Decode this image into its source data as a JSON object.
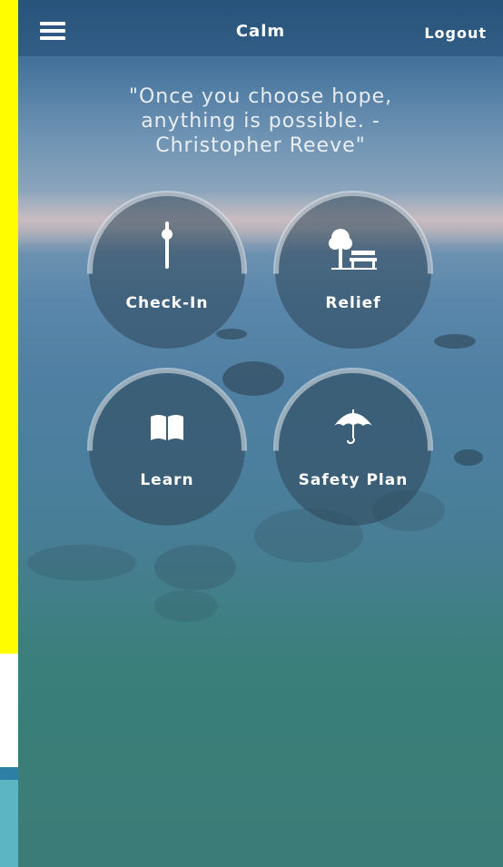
{
  "header": {
    "title": "Calm",
    "logout_label": "Logout"
  },
  "quote": {
    "lines": [
      "\"Once you choose hope,",
      "anything is possible. -",
      "Christopher Reeve\""
    ]
  },
  "tiles": [
    {
      "label": "Check-In",
      "icon": "thermometer-icon"
    },
    {
      "label": "Relief",
      "icon": "tree-bench-icon"
    },
    {
      "label": "Learn",
      "icon": "open-book-icon"
    },
    {
      "label": "Safety Plan",
      "icon": "umbrella-icon"
    }
  ]
}
